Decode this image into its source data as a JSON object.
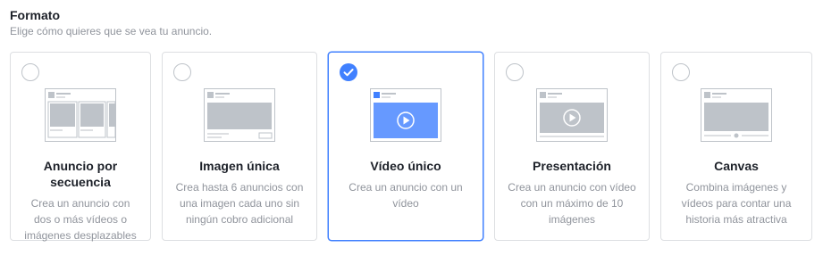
{
  "section": {
    "title": "Formato",
    "subtitle": "Elige cómo quieres que se vea tu anuncio."
  },
  "colors": {
    "accent": "#4080ff",
    "border": "#dddfe2",
    "muted_text": "#90949c",
    "illustration_gray": "#bec3c9"
  },
  "formats": [
    {
      "label": "Anuncio por secuencia",
      "description": "Crea un anuncio con dos o más vídeos o imágenes desplazables",
      "selected": false,
      "icon": "carousel-ad-icon"
    },
    {
      "label": "Imagen única",
      "description": "Crea hasta 6 anuncios con una imagen cada uno sin ningún cobro adicional",
      "selected": false,
      "icon": "single-image-ad-icon"
    },
    {
      "label": "Vídeo único",
      "description": "Crea un anuncio con un vídeo",
      "selected": true,
      "icon": "single-video-ad-icon"
    },
    {
      "label": "Presentación",
      "description": "Crea un anuncio con vídeo con un máximo de 10 imágenes",
      "selected": false,
      "icon": "slideshow-ad-icon"
    },
    {
      "label": "Canvas",
      "description": "Combina imágenes y vídeos para contar una historia más atractiva",
      "selected": false,
      "icon": "canvas-ad-icon"
    }
  ]
}
